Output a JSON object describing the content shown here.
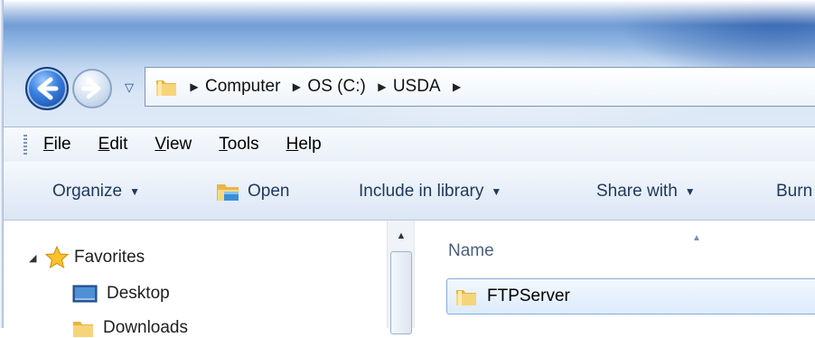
{
  "window": {
    "colors": {
      "frame": "#86aede",
      "accent": "#3a7fe0",
      "selection": "#dcebfc"
    }
  },
  "navigation": {
    "back_icon": "back-arrow-icon",
    "forward_icon": "forward-arrow-icon",
    "recent_icon": "chevron-down-icon"
  },
  "address_bar": {
    "icon": "folder-icon",
    "crumbs": [
      "Computer",
      "OS (C:)",
      "USDA"
    ]
  },
  "menu": {
    "items": [
      {
        "label": "File",
        "key": "F",
        "rest": "ile"
      },
      {
        "label": "Edit",
        "key": "E",
        "rest": "dit"
      },
      {
        "label": "View",
        "key": "V",
        "rest": "iew"
      },
      {
        "label": "Tools",
        "key": "T",
        "rest": "ools"
      },
      {
        "label": "Help",
        "key": "H",
        "rest": "elp"
      }
    ]
  },
  "toolbar": {
    "organize": "Organize",
    "open": "Open",
    "include_in_library": "Include in library",
    "share_with": "Share with",
    "burn": "Burn"
  },
  "nav_pane": {
    "favorites": "Favorites",
    "items": [
      "Desktop",
      "Downloads"
    ]
  },
  "file_list": {
    "column_name": "Name",
    "sorted": true,
    "rows": [
      {
        "name": "FTPServer",
        "selected": true
      }
    ]
  }
}
